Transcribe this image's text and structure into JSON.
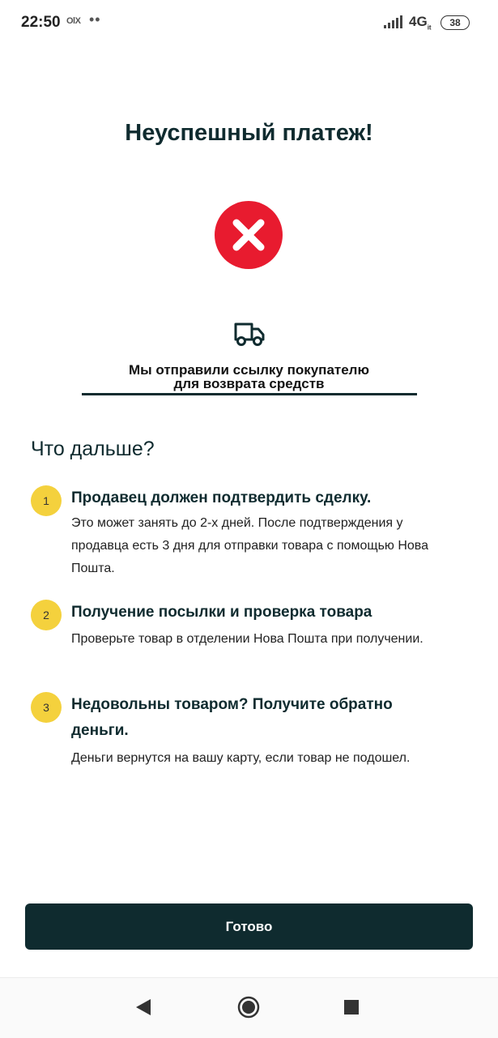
{
  "status_bar": {
    "time": "22:50",
    "notification_text": "OlX",
    "more_dots": "••",
    "network": "4G",
    "network_sub": "it",
    "battery": "38"
  },
  "page": {
    "title": "Неуспешный платеж!",
    "error_icon": "x-circle-icon",
    "truck_icon": "truck-icon",
    "notice_line1": "Мы отправили ссылку покупателю",
    "notice_line2": "для возврата средств"
  },
  "next_steps": {
    "heading": "Что дальше?",
    "steps": [
      {
        "number": "1",
        "title": "Продавец должен подтвердить сделку.",
        "description": "Это может занять до 2-х дней. После подтверждения у продавца есть 3 дня для отправки товара с помощью Нова Пошта."
      },
      {
        "number": "2",
        "title": "Получение посылки и проверка товара",
        "description": "Проверьте товар в отделении Нова Пошта при получении."
      },
      {
        "number": "3",
        "title": "Недовольны товаром? Получите обратно деньги.",
        "description": "Деньги вернутся на вашу карту, если товар не подошел."
      }
    ]
  },
  "actions": {
    "done_label": "Готово"
  },
  "colors": {
    "primary": "#0f2b2f",
    "error": "#e81b2f",
    "badge": "#f4d13d"
  }
}
